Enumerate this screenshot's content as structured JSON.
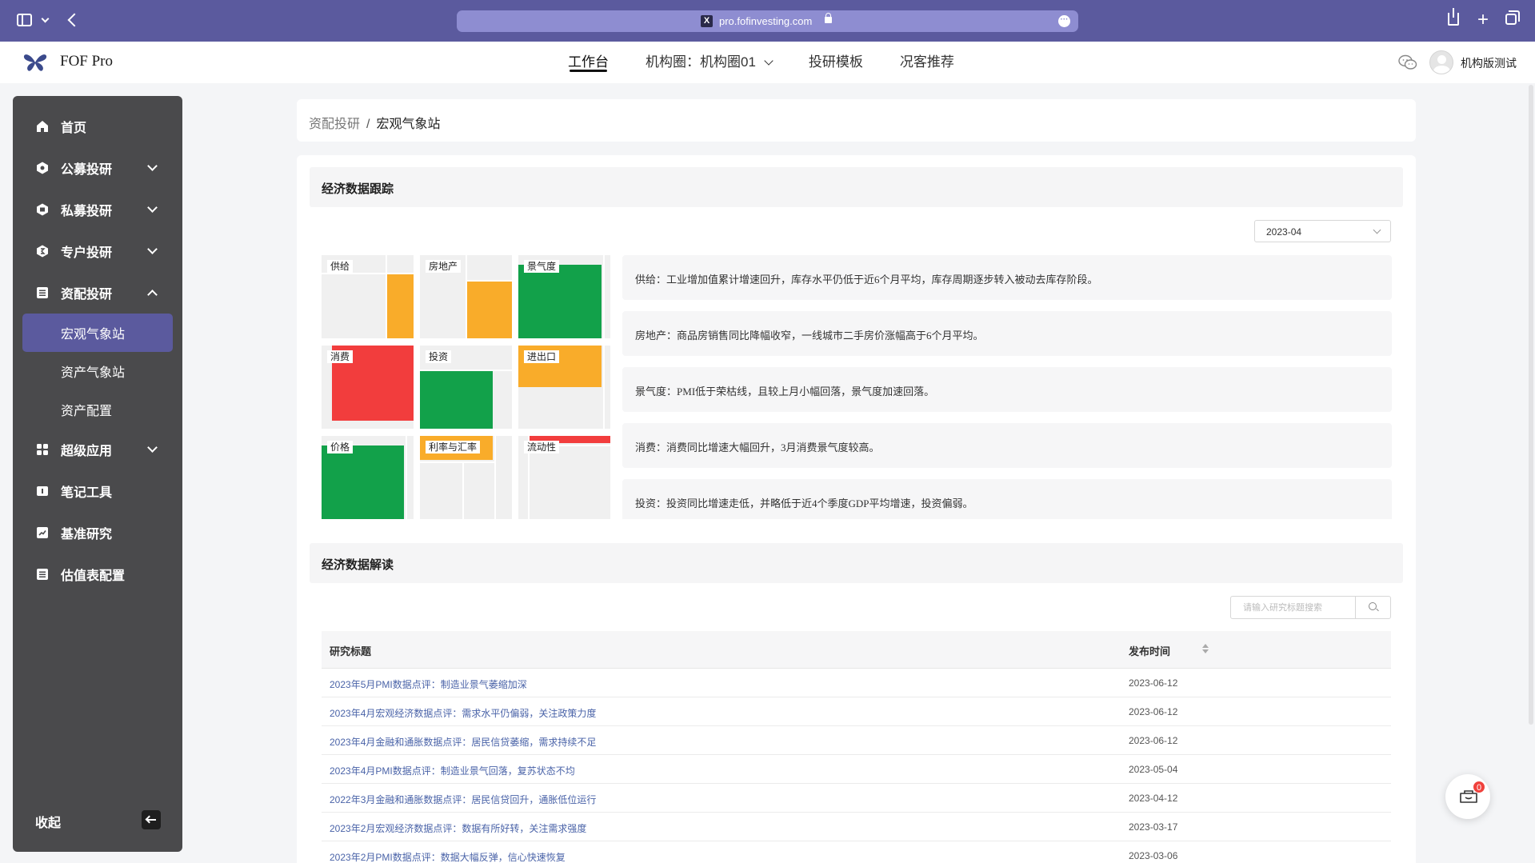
{
  "browser": {
    "url": "pro.fofinvesting.com",
    "favicon_letter": "X"
  },
  "header": {
    "logo_text": "FOF Pro",
    "nav": [
      {
        "label": "工作台",
        "active": true
      },
      {
        "label": "机构圈：机构圈01",
        "active": false
      },
      {
        "label": "投研模板",
        "active": false
      },
      {
        "label": "况客推荐",
        "active": false
      }
    ],
    "user_name": "机构版测试"
  },
  "sidebar": {
    "items": [
      {
        "label": "首页",
        "icon": "home-icon"
      },
      {
        "label": "公募投研",
        "icon": "public-fund-icon"
      },
      {
        "label": "私募投研",
        "icon": "private-fund-icon"
      },
      {
        "label": "专户投研",
        "icon": "special-account-icon"
      },
      {
        "label": "资配投研",
        "icon": "allocation-icon"
      },
      {
        "label": "超级应用",
        "icon": "apps-icon"
      },
      {
        "label": "笔记工具",
        "icon": "notes-icon"
      },
      {
        "label": "基准研究",
        "icon": "benchmark-icon"
      },
      {
        "label": "估值表配置",
        "icon": "valuation-icon"
      }
    ],
    "sub_items": [
      {
        "label": "宏观气象站",
        "active": true
      },
      {
        "label": "资产气象站",
        "active": false
      },
      {
        "label": "资产配置",
        "active": false
      }
    ],
    "collapse_label": "收起"
  },
  "breadcrumb": {
    "parent": "资配投研",
    "separator": "/",
    "current": "宏观气象站"
  },
  "tracking": {
    "title": "经济数据跟踪",
    "selected_month": "2023-04",
    "heatmap": [
      {
        "label": "供给",
        "color": "#f9ac2a"
      },
      {
        "label": "房地产",
        "color": "#f9ac2a"
      },
      {
        "label": "景气度",
        "color": "#12a14a"
      },
      {
        "label": "消费",
        "color": "#f23d3d"
      },
      {
        "label": "投资",
        "color": "#12a14a"
      },
      {
        "label": "进出口",
        "color": "#f9ac2a"
      },
      {
        "label": "价格",
        "color": "#12a14a"
      },
      {
        "label": "利率与汇率",
        "color": "#f9ac2a"
      },
      {
        "label": "流动性",
        "color": "#f23d3d"
      }
    ],
    "descriptions": [
      {
        "key": "供给",
        "text": "工业增加值累计增速回升，库存水平仍低于近6个月平均，库存周期逐步转入被动去库存阶段。"
      },
      {
        "key": "房地产",
        "text": "商品房销售同比降幅收窄，一线城市二手房价涨幅高于6个月平均。"
      },
      {
        "key": "景气度",
        "text": "PMI低于荣枯线，且较上月小幅回落，景气度加速回落。"
      },
      {
        "key": "消费",
        "text": "消费同比增速大幅回升，3月消费景气度较高。"
      },
      {
        "key": "投资",
        "text": "投资同比增速走低，并略低于近4个季度GDP平均增速，投资偏弱。"
      }
    ],
    "desc_separator": "："
  },
  "reading": {
    "title": "经济数据解读",
    "search_placeholder": "请输入研究标题搜索",
    "columns": [
      "研究标题",
      "发布时间"
    ],
    "rows": [
      {
        "title": "2023年5月PMI数据点评：制造业景气萎缩加深",
        "date": "2023-06-12"
      },
      {
        "title": "2023年4月宏观经济数据点评：需求水平仍偏弱，关注政策力度",
        "date": "2023-06-12"
      },
      {
        "title": "2023年4月金融和通胀数据点评：居民信贷萎缩，需求持续不足",
        "date": "2023-06-12"
      },
      {
        "title": "2023年4月PMI数据点评：制造业景气回落，复苏状态不均",
        "date": "2023-05-04"
      },
      {
        "title": "2022年3月金融和通胀数据点评：居民信贷回升，通胀低位运行",
        "date": "2023-04-12"
      },
      {
        "title": "2023年2月宏观经济数据点评：数据有所好转，关注需求强度",
        "date": "2023-03-17"
      },
      {
        "title": "2023年2月PMI数据点评：数据大幅反弹，信心快速恢复",
        "date": "2023-03-06"
      }
    ]
  },
  "cart": {
    "badge_count": "0"
  }
}
